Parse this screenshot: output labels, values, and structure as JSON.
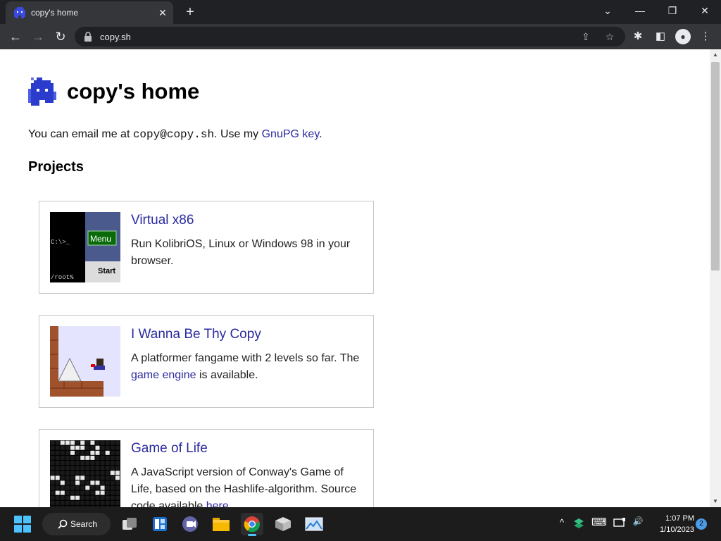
{
  "browser": {
    "tab": {
      "title": "copy's home",
      "close_glyph": "✕"
    },
    "new_tab_glyph": "+",
    "window_controls": {
      "list": "⌄",
      "minimize": "—",
      "restore": "❐",
      "close": "✕"
    },
    "nav": {
      "back": "←",
      "forward": "→",
      "reload": "↻"
    },
    "url": "copy.sh",
    "omnibox_icons": {
      "share": "⇪",
      "bookmark": "☆"
    },
    "toolbar_icons": {
      "extensions": "✱",
      "side_panel": "◧",
      "profile": "●",
      "menu": "⋮"
    }
  },
  "page": {
    "title": "copy's home",
    "email_prefix": "You can email me at ",
    "email": "copy@copy.sh",
    "email_mid": ". Use my ",
    "gnupg_link": "GnuPG key",
    "email_suffix": ".",
    "projects_heading": "Projects",
    "projects": [
      {
        "title": "Virtual x86",
        "desc": "Run KolibriOS, Linux or Windows 98 in your browser.",
        "thumb": {
          "prompt": "C:\\>_",
          "menu": "Menu",
          "start": "Start",
          "root": "/root%"
        }
      },
      {
        "title": "I Wanna Be Thy Copy",
        "desc_pre": "A platformer fangame with 2 levels so far. The ",
        "desc_link": "game engine",
        "desc_post": " is available."
      },
      {
        "title": "Game of Life",
        "desc_pre": "A JavaScript version of Conway's Game of Life, based on the Hashlife-algorithm. Source code available ",
        "desc_link": "here",
        "desc_post": "."
      }
    ]
  },
  "taskbar": {
    "search_label": "Search",
    "clock_time": "1:07 PM",
    "clock_date": "1/10/2023",
    "notification_count": "2",
    "tray": {
      "chevron": "^",
      "keyboard": "⌨",
      "volume": "🔊"
    }
  },
  "colors": {
    "link": "#2a2aa0",
    "logo": "#2b3bcc",
    "accent": "#4b9ce6"
  }
}
